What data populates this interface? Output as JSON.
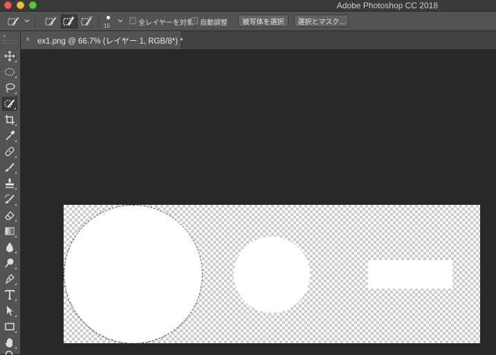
{
  "window": {
    "app_title": "Adobe Photoshop CC 2018"
  },
  "options_bar": {
    "brush_size": "15",
    "sample_all_layers_label": "全レイヤーを対象",
    "sample_all_layers_checked": false,
    "auto_enhance_label": "自動調整",
    "auto_enhance_checked": false,
    "select_subject_button": "被写体を選択",
    "select_and_mask_button": "選択とマスク..."
  },
  "document_tab": {
    "close_glyph": "×",
    "title": "ex1.png @ 66.7% (レイヤー 1, RGB/8*) *"
  },
  "tools_panel": {
    "collapse_glyph": "››",
    "tools": [
      {
        "name": "move-tool",
        "icon": "move-icon",
        "active": false
      },
      {
        "name": "elliptical-marquee-tool",
        "icon": "ellipse-marquee-icon",
        "active": false
      },
      {
        "name": "lasso-tool",
        "icon": "lasso-icon",
        "active": false
      },
      {
        "name": "quick-selection-tool",
        "icon": "quick-selection-brush-icon",
        "active": true
      },
      {
        "name": "crop-tool",
        "icon": "crop-icon",
        "active": false
      },
      {
        "name": "eyedropper-tool",
        "icon": "eyedropper-icon",
        "active": false
      },
      {
        "name": "healing-brush-tool",
        "icon": "bandage-icon",
        "active": false
      },
      {
        "name": "brush-tool",
        "icon": "brush-icon",
        "active": false
      },
      {
        "name": "clone-stamp-tool",
        "icon": "stamp-icon",
        "active": false
      },
      {
        "name": "history-brush-tool",
        "icon": "history-brush-icon",
        "active": false
      },
      {
        "name": "eraser-tool",
        "icon": "eraser-icon",
        "active": false
      },
      {
        "name": "gradient-tool",
        "icon": "gradient-icon",
        "active": false
      },
      {
        "name": "blur-tool",
        "icon": "droplet-icon",
        "active": false
      },
      {
        "name": "dodge-tool",
        "icon": "dodge-icon",
        "active": false
      },
      {
        "name": "pen-tool",
        "icon": "pen-icon",
        "active": false
      },
      {
        "name": "type-tool",
        "icon": "type-icon",
        "active": false
      },
      {
        "name": "path-selection-tool",
        "icon": "arrow-cursor-icon",
        "active": false
      },
      {
        "name": "rectangle-tool",
        "icon": "rectangle-icon",
        "active": false
      },
      {
        "name": "hand-tool",
        "icon": "hand-icon",
        "active": false
      },
      {
        "name": "zoom-tool",
        "icon": "zoom-icon",
        "active": false
      }
    ]
  },
  "colors": {
    "workspace_bg": "#282828",
    "panel_bg": "#535353",
    "titlebar_bg": "#3a3a3a",
    "close": "#ee5e55",
    "minimize": "#f5bd3c",
    "maximize": "#5dc745",
    "shape_fill": "#ffffff"
  }
}
